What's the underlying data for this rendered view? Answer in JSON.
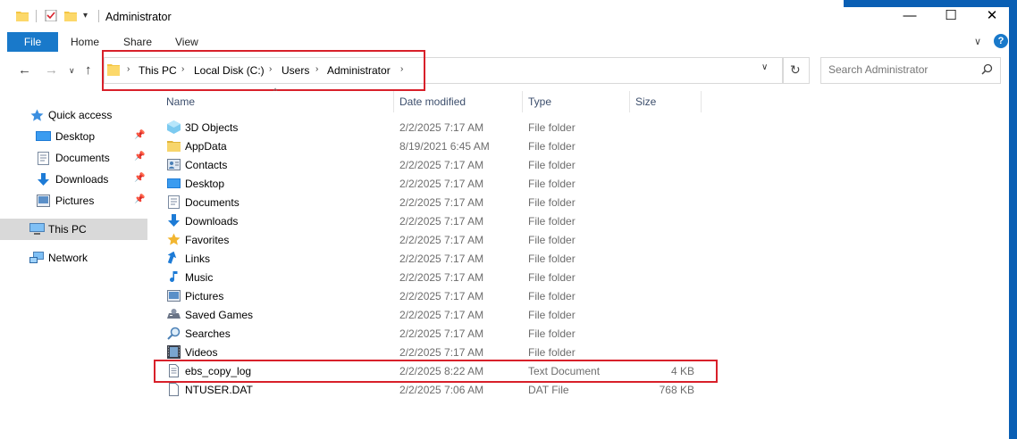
{
  "window": {
    "title": "Administrator",
    "minimize": "—",
    "maximize": "☐",
    "close": "✕"
  },
  "ribbon": {
    "file": "File",
    "home": "Home",
    "share": "Share",
    "view": "View",
    "help": "?"
  },
  "address": {
    "crumbs": [
      "This PC",
      "Local Disk (C:)",
      "Users",
      "Administrator"
    ]
  },
  "search": {
    "placeholder": "Search Administrator"
  },
  "sidebar": {
    "items": [
      {
        "label": "Quick access",
        "icon": "star-icon"
      },
      {
        "label": "Desktop",
        "icon": "desktop-icon",
        "pinned": true
      },
      {
        "label": "Documents",
        "icon": "documents-icon",
        "pinned": true
      },
      {
        "label": "Downloads",
        "icon": "downloads-icon",
        "pinned": true
      },
      {
        "label": "Pictures",
        "icon": "pictures-icon",
        "pinned": true
      },
      {
        "label": "This PC",
        "icon": "computer-icon",
        "selected": true
      },
      {
        "label": "Network",
        "icon": "network-icon"
      }
    ]
  },
  "columns": {
    "name": "Name",
    "date": "Date modified",
    "type": "Type",
    "size": "Size"
  },
  "files": [
    {
      "name": "3D Objects",
      "date": "2/2/2025 7:17 AM",
      "type": "File folder",
      "size": "",
      "icon": "3d-objects-icon"
    },
    {
      "name": "AppData",
      "date": "8/19/2021 6:45 AM",
      "type": "File folder",
      "size": "",
      "icon": "folder-icon"
    },
    {
      "name": "Contacts",
      "date": "2/2/2025 7:17 AM",
      "type": "File folder",
      "size": "",
      "icon": "contacts-icon"
    },
    {
      "name": "Desktop",
      "date": "2/2/2025 7:17 AM",
      "type": "File folder",
      "size": "",
      "icon": "desktop-icon"
    },
    {
      "name": "Documents",
      "date": "2/2/2025 7:17 AM",
      "type": "File folder",
      "size": "",
      "icon": "documents-icon"
    },
    {
      "name": "Downloads",
      "date": "2/2/2025 7:17 AM",
      "type": "File folder",
      "size": "",
      "icon": "downloads-icon"
    },
    {
      "name": "Favorites",
      "date": "2/2/2025 7:17 AM",
      "type": "File folder",
      "size": "",
      "icon": "star-icon"
    },
    {
      "name": "Links",
      "date": "2/2/2025 7:17 AM",
      "type": "File folder",
      "size": "",
      "icon": "links-icon"
    },
    {
      "name": "Music",
      "date": "2/2/2025 7:17 AM",
      "type": "File folder",
      "size": "",
      "icon": "music-icon"
    },
    {
      "name": "Pictures",
      "date": "2/2/2025 7:17 AM",
      "type": "File folder",
      "size": "",
      "icon": "pictures-icon"
    },
    {
      "name": "Saved Games",
      "date": "2/2/2025 7:17 AM",
      "type": "File folder",
      "size": "",
      "icon": "saved-games-icon"
    },
    {
      "name": "Searches",
      "date": "2/2/2025 7:17 AM",
      "type": "File folder",
      "size": "",
      "icon": "search-icon"
    },
    {
      "name": "Videos",
      "date": "2/2/2025 7:17 AM",
      "type": "File folder",
      "size": "",
      "icon": "videos-icon"
    },
    {
      "name": "ebs_copy_log",
      "date": "2/2/2025 8:22 AM",
      "type": "Text Document",
      "size": "4 KB",
      "icon": "text-file-icon"
    },
    {
      "name": "NTUSER.DAT",
      "date": "2/2/2025 7:06 AM",
      "type": "DAT File",
      "size": "768 KB",
      "icon": "file-icon"
    }
  ],
  "colors": {
    "accent": "#1979ca",
    "highlight_box": "#d8202a",
    "selected_nav": "#d9d9d9"
  }
}
